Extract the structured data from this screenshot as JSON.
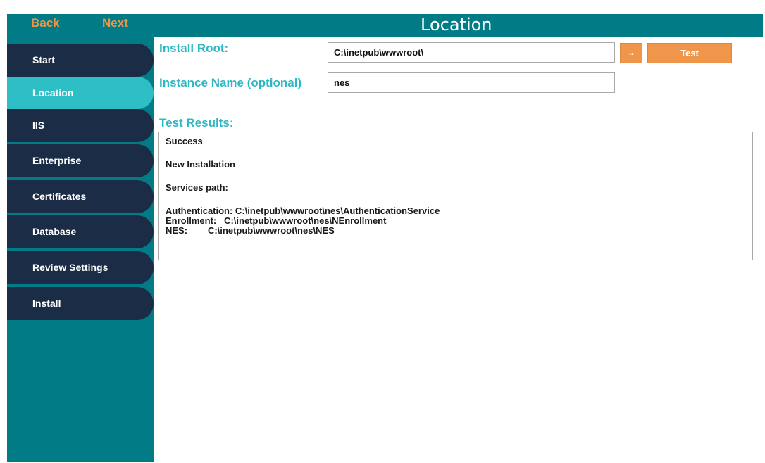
{
  "nav": {
    "back": "Back",
    "next": "Next"
  },
  "header": {
    "title": "Location"
  },
  "sidebar": {
    "items": [
      {
        "label": "Start"
      },
      {
        "label": "Location",
        "active": true
      },
      {
        "label": "IIS"
      },
      {
        "label": "Enterprise"
      },
      {
        "label": "Certificates"
      },
      {
        "label": "Database"
      },
      {
        "label": "Review Settings"
      },
      {
        "label": "Install"
      }
    ]
  },
  "form": {
    "install_root_label": "Install Root:",
    "install_root_value": "C:\\inetpub\\wwwroot\\",
    "browse_label": "..",
    "test_label": "Test",
    "instance_name_label": "Instance Name (optional)",
    "instance_name_value": "nes"
  },
  "results": {
    "label": "Test Results:",
    "lines": [
      "Success",
      "",
      "New Installation",
      "",
      "Services path:",
      "",
      "Authentication: C:\\inetpub\\wwwroot\\nes\\AuthenticationService",
      "Enrollment:   C:\\inetpub\\wwwroot\\nes\\NEnrollment",
      "NES:        C:\\inetpub\\wwwroot\\nes\\NES"
    ]
  },
  "colors": {
    "app_background": "#017c86",
    "sidebar_item": "#1b2d46",
    "sidebar_active": "#2ebec6",
    "accent_orange": "#f0964a",
    "label_teal": "#2db8c4"
  }
}
